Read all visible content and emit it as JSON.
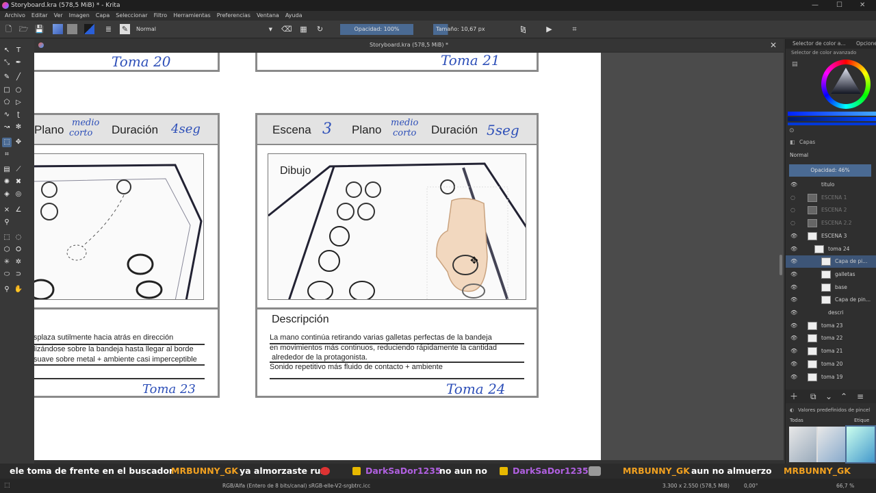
{
  "window": {
    "title": "Storyboard.kra (578,5 MiB) * - Krita"
  },
  "menu": [
    "Archivo",
    "Editar",
    "Ver",
    "Imagen",
    "Capa",
    "Seleccionar",
    "Filtro",
    "Herramientas",
    "Preferencias",
    "Ventana",
    "Ayuda"
  ],
  "toolbar": {
    "blend_mode": "Normal",
    "opacity": "Opacidad: 100%",
    "size": "Tamaño: 10,67 px"
  },
  "document_tab": {
    "title": "Storyboard.kra (578,5 MiB) *"
  },
  "storyboard": {
    "top_left_take": "Toma 20",
    "top_right_take": "Toma 21",
    "left": {
      "plano_label": "Plano",
      "plano_value_1": "medio",
      "plano_value_2": "corto",
      "duracion_label": "Duración",
      "duracion_value": "4seg",
      "desc_lines": [
        "splaza sutilmente hacia atrás en dirección",
        "lizándose sobre la bandeja hasta llegar al borde",
        "suave sobre metal + ambiente casi imperceptible"
      ],
      "take": "Toma 23"
    },
    "right": {
      "escena_label": "Escena",
      "escena_value": "3",
      "plano_label": "Plano",
      "plano_value_1": "medio",
      "plano_value_2": "corto",
      "duracion_label": "Duración",
      "duracion_value": "5seg",
      "dibujo_label": "Dibujo",
      "desc_title": "Descripción",
      "desc_lines": [
        "La mano continúa retirando varias galletas perfectas de la bandeja",
        "en movimientos más continuos, reduciendo rápidamente la cantidad",
        "alrededor de la protagonista.",
        "Sonido repetitivo más fluido de contacto + ambiente"
      ],
      "take": "Toma 24"
    }
  },
  "right_panel": {
    "tab_color": "Selector de color a...",
    "tab_options": "Opcione",
    "color_selector_label": "Selector de color avanzado",
    "layers_title": "Capas",
    "layer_blend": "Normal",
    "layer_opacity": "Opacidad: 46%",
    "layers": [
      {
        "name": "titulo"
      },
      {
        "name": "ESCENA 1"
      },
      {
        "name": "ESCENA 2"
      },
      {
        "name": "ESCENA 2.2"
      },
      {
        "name": "ESCENA 3"
      },
      {
        "name": "toma 24"
      },
      {
        "name": "Capa de pi..."
      },
      {
        "name": "galletas"
      },
      {
        "name": "base"
      },
      {
        "name": "Capa de pin..."
      },
      {
        "name": "descri"
      },
      {
        "name": "toma 23"
      },
      {
        "name": "toma 22"
      },
      {
        "name": "toma 21"
      },
      {
        "name": "toma 20"
      },
      {
        "name": "toma 19"
      }
    ],
    "brush_presets_title": "Valores predefinidos de pincel",
    "brush_filter": "Todas",
    "brush_tag": "Etique"
  },
  "ticker": [
    {
      "user": "",
      "text": "ele toma de frente en el buscador"
    },
    {
      "user": "MRBUNNY_GK",
      "text": "ya almorzaste ruz"
    },
    {
      "user": "DarkSaDor1235",
      "text": "no aun no"
    },
    {
      "user": "DarkSaDor1235",
      "text": ""
    },
    {
      "user": "MRBUNNY_GK",
      "text": "aun no almuerzo"
    },
    {
      "user": "MRBUNNY_GK",
      "text": ""
    }
  ],
  "status": {
    "color_space": "RGB/Alfa (Entero de 8 bits/canal)  sRGB-elle-V2-srgbtrc.icc",
    "dimensions": "3.300 x 2.550 (578,5 MiB)",
    "rotation": "0,00°",
    "zoom": "66,7 %"
  },
  "colors": {
    "accent": "#4a6a93",
    "blue_ink": "#2d4fb8",
    "user_orange": "#f0a020",
    "user_purple": "#b060e0"
  }
}
